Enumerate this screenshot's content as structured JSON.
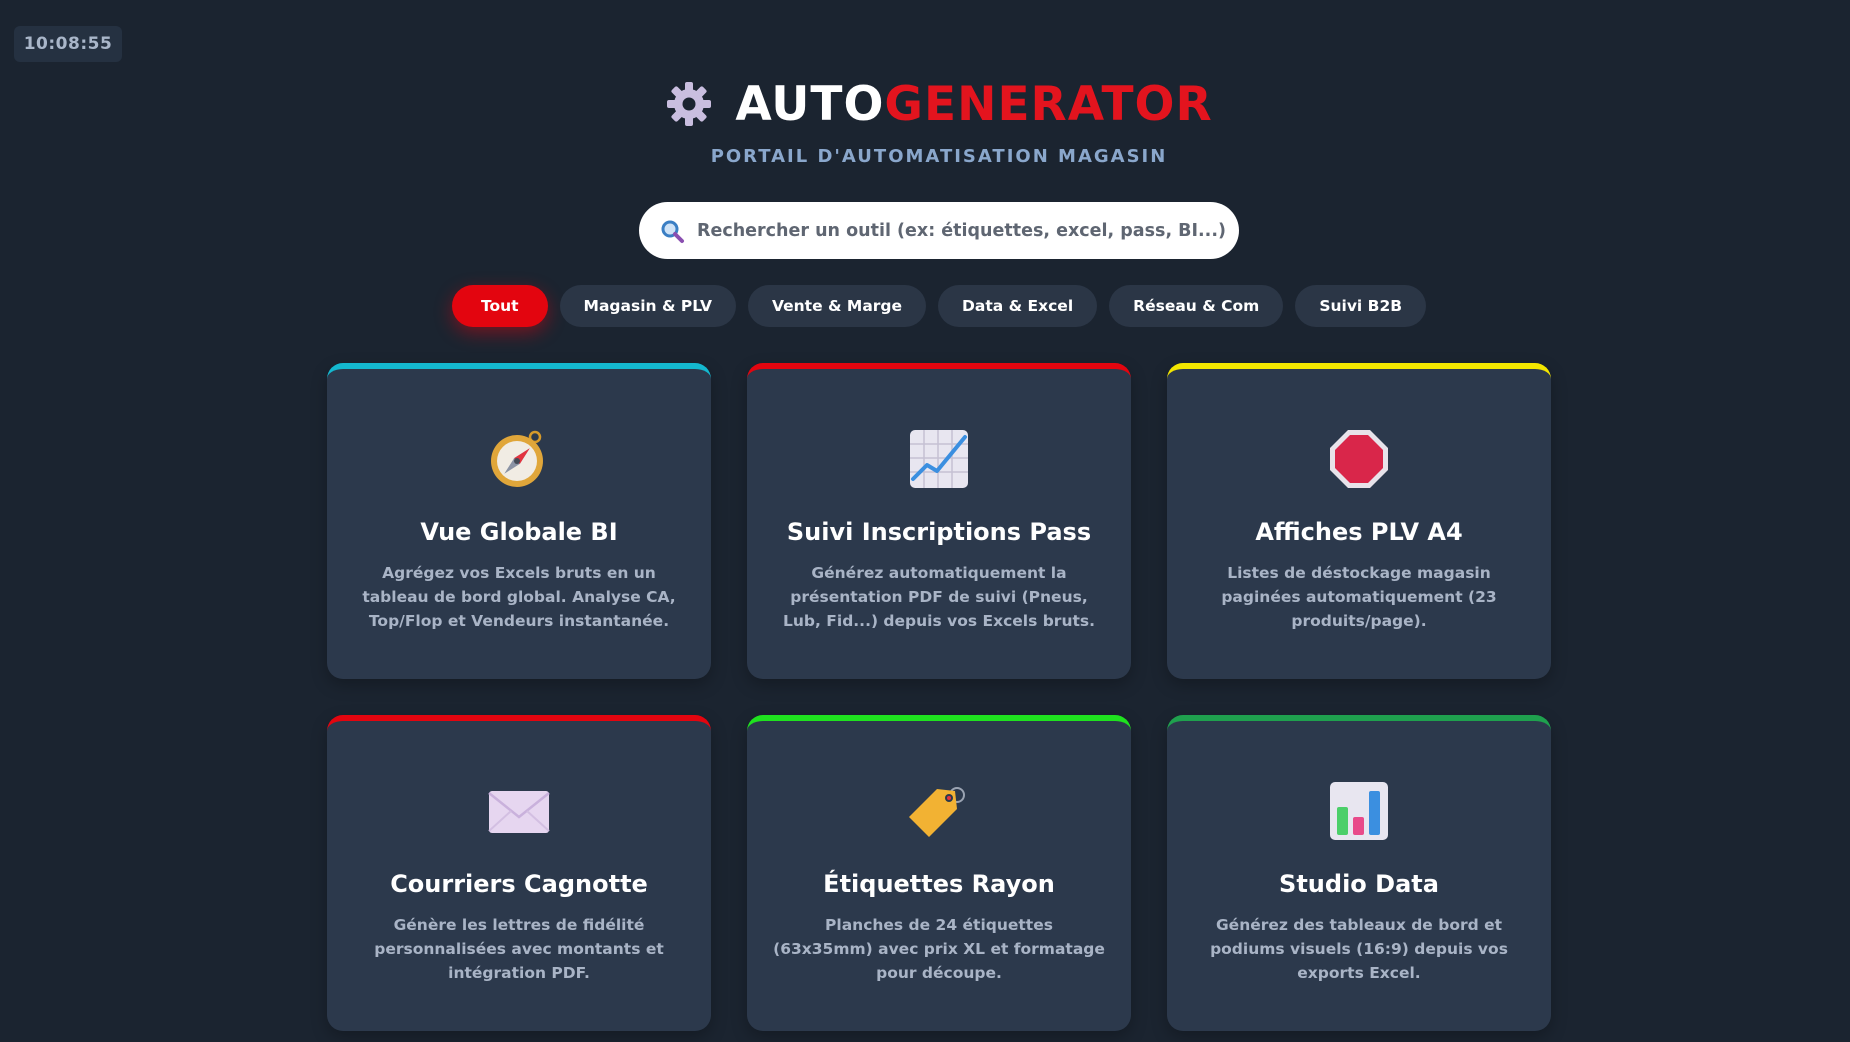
{
  "clock": "10:08:55",
  "brand": {
    "part1": "AUTO",
    "part2": "GENERATOR",
    "subtitle": "PORTAIL D'AUTOMATISATION MAGASIN"
  },
  "search": {
    "placeholder": "Rechercher un outil (ex: étiquettes, excel, pass, BI...)"
  },
  "filters": [
    "Tout",
    "Magasin & PLV",
    "Vente & Marge",
    "Data & Excel",
    "Réseau & Com",
    "Suivi B2B"
  ],
  "active_filter": "Tout",
  "colors": {
    "accent": "#e3050f",
    "background": "#1b2430",
    "card": "#2c394c"
  },
  "cards": [
    {
      "title": "Vue Globale BI",
      "desc": "Agrégez vos Excels bruts en un tableau de bord global. Analyse CA, Top/Flop et Vendeurs instantanée.",
      "icon": "compass-icon",
      "color": "#14b8cf"
    },
    {
      "title": "Suivi Inscriptions Pass",
      "desc": "Générez automatiquement la présentation PDF de suivi (Pneus, Lub, Fid...) depuis vos Excels bruts.",
      "icon": "chart-increasing-icon",
      "color": "#e3050f"
    },
    {
      "title": "Affiches PLV A4",
      "desc": "Listes de déstockage magasin paginées automatiquement (23 produits/page).",
      "icon": "stop-sign-icon",
      "color": "#f3e600"
    },
    {
      "title": "Courriers Cagnotte",
      "desc": "Génère les lettres de fidélité personnalisées avec montants et intégration PDF.",
      "icon": "envelope-icon",
      "color": "#e3050f"
    },
    {
      "title": "Étiquettes Rayon",
      "desc": "Planches de 24 étiquettes (63x35mm) avec prix XL et formatage pour découpe.",
      "icon": "label-tag-icon",
      "color": "#1fe21f"
    },
    {
      "title": "Studio Data",
      "desc": "Générez des tableaux de bord et podiums visuels (16:9) depuis vos exports Excel.",
      "icon": "bar-chart-icon",
      "color": "#1fa14e"
    }
  ]
}
